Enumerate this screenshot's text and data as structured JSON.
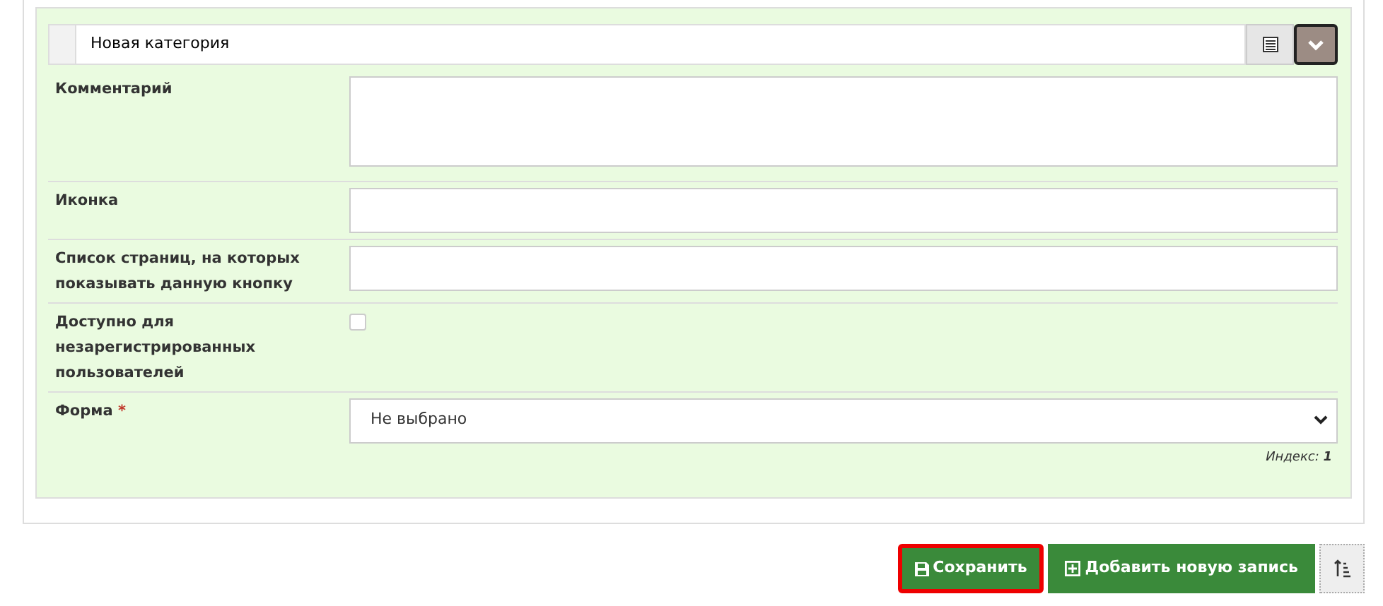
{
  "header": {
    "value": "Новая категория"
  },
  "fields": [
    {
      "kind": "textarea",
      "label": "Комментарий"
    },
    {
      "kind": "text",
      "label": "Иконка"
    },
    {
      "kind": "text",
      "label": "Список страниц, на которых показывать данную кнопку"
    },
    {
      "kind": "checkbox",
      "label": "Доступно для незарегистрированных пользователей",
      "checked": false
    },
    {
      "kind": "select",
      "label": "Форма",
      "required_mark": "*",
      "value": "Не выбрано"
    }
  ],
  "index_text": "Индекс: **1**",
  "buttons": [
    {
      "kind": "save",
      "label": "Сохранить",
      "selected": true
    },
    {
      "kind": "add",
      "label": "Добавить новую запись",
      "selected": false
    },
    {
      "kind": "sort",
      "selected": false
    }
  ]
}
